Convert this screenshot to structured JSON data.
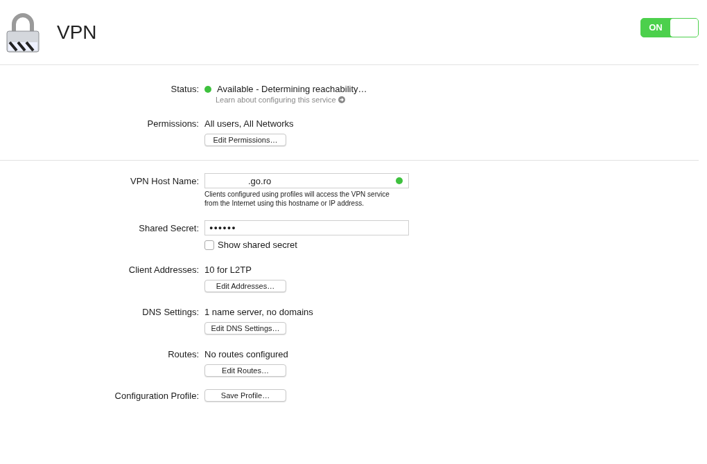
{
  "header": {
    "title": "VPN",
    "toggle": {
      "label": "ON",
      "on": true
    }
  },
  "status": {
    "label": "Status:",
    "value": "Available - Determining reachability…",
    "color": "#3ec13e",
    "link": "Learn about configuring this service"
  },
  "permissions": {
    "label": "Permissions:",
    "value": "All users, All Networks",
    "button": "Edit Permissions…"
  },
  "rows": [
    {
      "kind": "text_field",
      "label": "VPN Host Name:",
      "value": ".go.ro",
      "color": "#3ec13e",
      "help": "Clients configured using profiles will access the VPN service\nfrom the Internet using this hostname or IP address."
    },
    {
      "kind": "secret_field",
      "label": "Shared Secret:",
      "value": "●●●●●●",
      "checkbox": {
        "label": "Show shared secret",
        "checked": false
      }
    },
    {
      "kind": "info_button",
      "label": "Client Addresses:",
      "value": "10 for L2TP",
      "button": "Edit Addresses…"
    },
    {
      "kind": "info_button",
      "label": "DNS Settings:",
      "value": "1 name server, no domains",
      "button": "Edit DNS Settings…"
    },
    {
      "kind": "info_button",
      "label": "Routes:",
      "value": "No routes configured",
      "button": "Edit Routes…"
    },
    {
      "kind": "button",
      "label": "Configuration Profile:",
      "button": "Save Profile…"
    }
  ]
}
